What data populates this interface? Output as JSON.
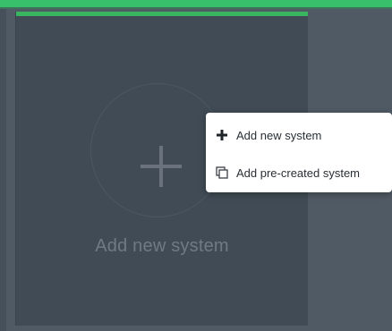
{
  "card": {
    "label": "Add new system"
  },
  "menu": {
    "items": [
      {
        "label": "Add new system",
        "icon": "plus-icon"
      },
      {
        "label": "Add pre-created system",
        "icon": "copy-icon"
      }
    ]
  },
  "colors": {
    "accent": "#39b55f",
    "background": "#505a65",
    "card": "#414b55",
    "menu_bg": "#ffffff"
  }
}
